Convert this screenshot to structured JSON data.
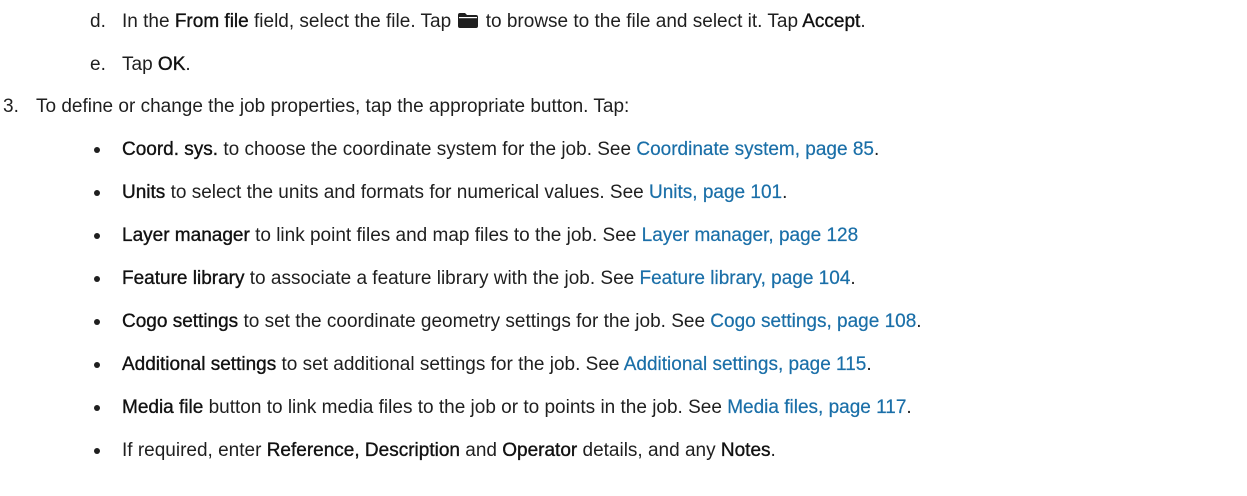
{
  "steps": {
    "d": {
      "marker": "d.",
      "t1": "In the ",
      "b1": "From file",
      "t2": " field, select the file. Tap ",
      "icon": "folder-icon",
      "t3": " to browse to the file and select it. Tap ",
      "b2": "Accept",
      "t4": "."
    },
    "e": {
      "marker": "e.",
      "t1": "Tap ",
      "b1": "OK",
      "t2": "."
    },
    "three": {
      "marker": "3.",
      "text": "To define or change the job properties, tap the appropriate button. Tap:"
    }
  },
  "bullets": [
    {
      "bold": "Coord. sys.",
      "text": " to choose the coordinate system for the job. See ",
      "link": "Coordinate system, page 85",
      "end": "."
    },
    {
      "bold": "Units",
      "text": " to select the units and formats for numerical values. See ",
      "link": "Units, page 101",
      "end": "."
    },
    {
      "bold": "Layer manager",
      "text": " to link point files and map files to the job. See ",
      "link": "Layer manager, page 128",
      "end": ""
    },
    {
      "bold": "Feature library",
      "text": " to associate a feature library with the job. See ",
      "link": "Feature library, page 104",
      "end": "."
    },
    {
      "bold": "Cogo settings",
      "text": " to set the coordinate geometry settings for the job. See ",
      "link": "Cogo settings, page 108",
      "end": "."
    },
    {
      "bold": "Additional settings",
      "text": " to set additional settings for the job. See ",
      "link": "Additional settings, page 115",
      "end": "."
    },
    {
      "bold": "Media file",
      "text": " button to link media files to the job or to points in the job. See ",
      "link": "Media files, page 117",
      "end": "."
    }
  ],
  "last_bullet": {
    "t1": "If required, enter ",
    "b1": "Reference, Description",
    "t2": " and ",
    "b2": "Operator",
    "t3": " details, and any ",
    "b3": "Notes",
    "t4": "."
  },
  "colors": {
    "text": "#1f1f1f",
    "link": "#1a6fa8"
  }
}
